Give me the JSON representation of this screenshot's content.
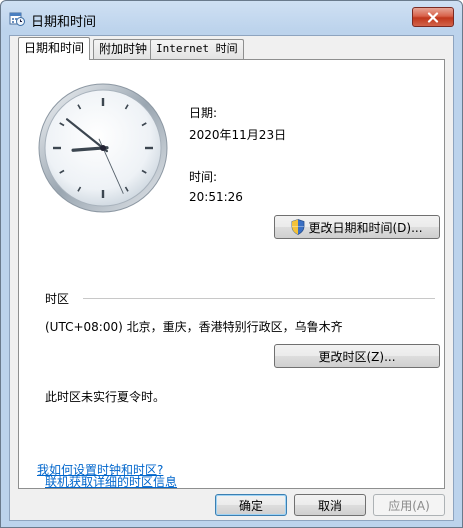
{
  "window": {
    "title": "日期和时间"
  },
  "tabs": [
    {
      "label": "日期和时间"
    },
    {
      "label": "附加时钟"
    },
    {
      "label": "Internet 时间"
    }
  ],
  "clock": {
    "hour": 20,
    "minute": 51,
    "second": 26
  },
  "date": {
    "label": "日期:",
    "value": "2020年11月23日"
  },
  "time": {
    "label": "时间:",
    "value": "20:51:26"
  },
  "change_datetime_button": "更改日期和时间(D)...",
  "timezone": {
    "heading": "时区",
    "value": "(UTC+08:00) 北京，重庆，香港特别行政区，乌鲁木齐",
    "change_button": "更改时区(Z)...",
    "dst_note": "此时区未实行夏令时。"
  },
  "links": {
    "online_info": "联机获取详细的时区信息",
    "how_to": "我如何设置时钟和时区?"
  },
  "buttons": {
    "ok": "确定",
    "cancel": "取消",
    "apply": "应用(A)"
  }
}
